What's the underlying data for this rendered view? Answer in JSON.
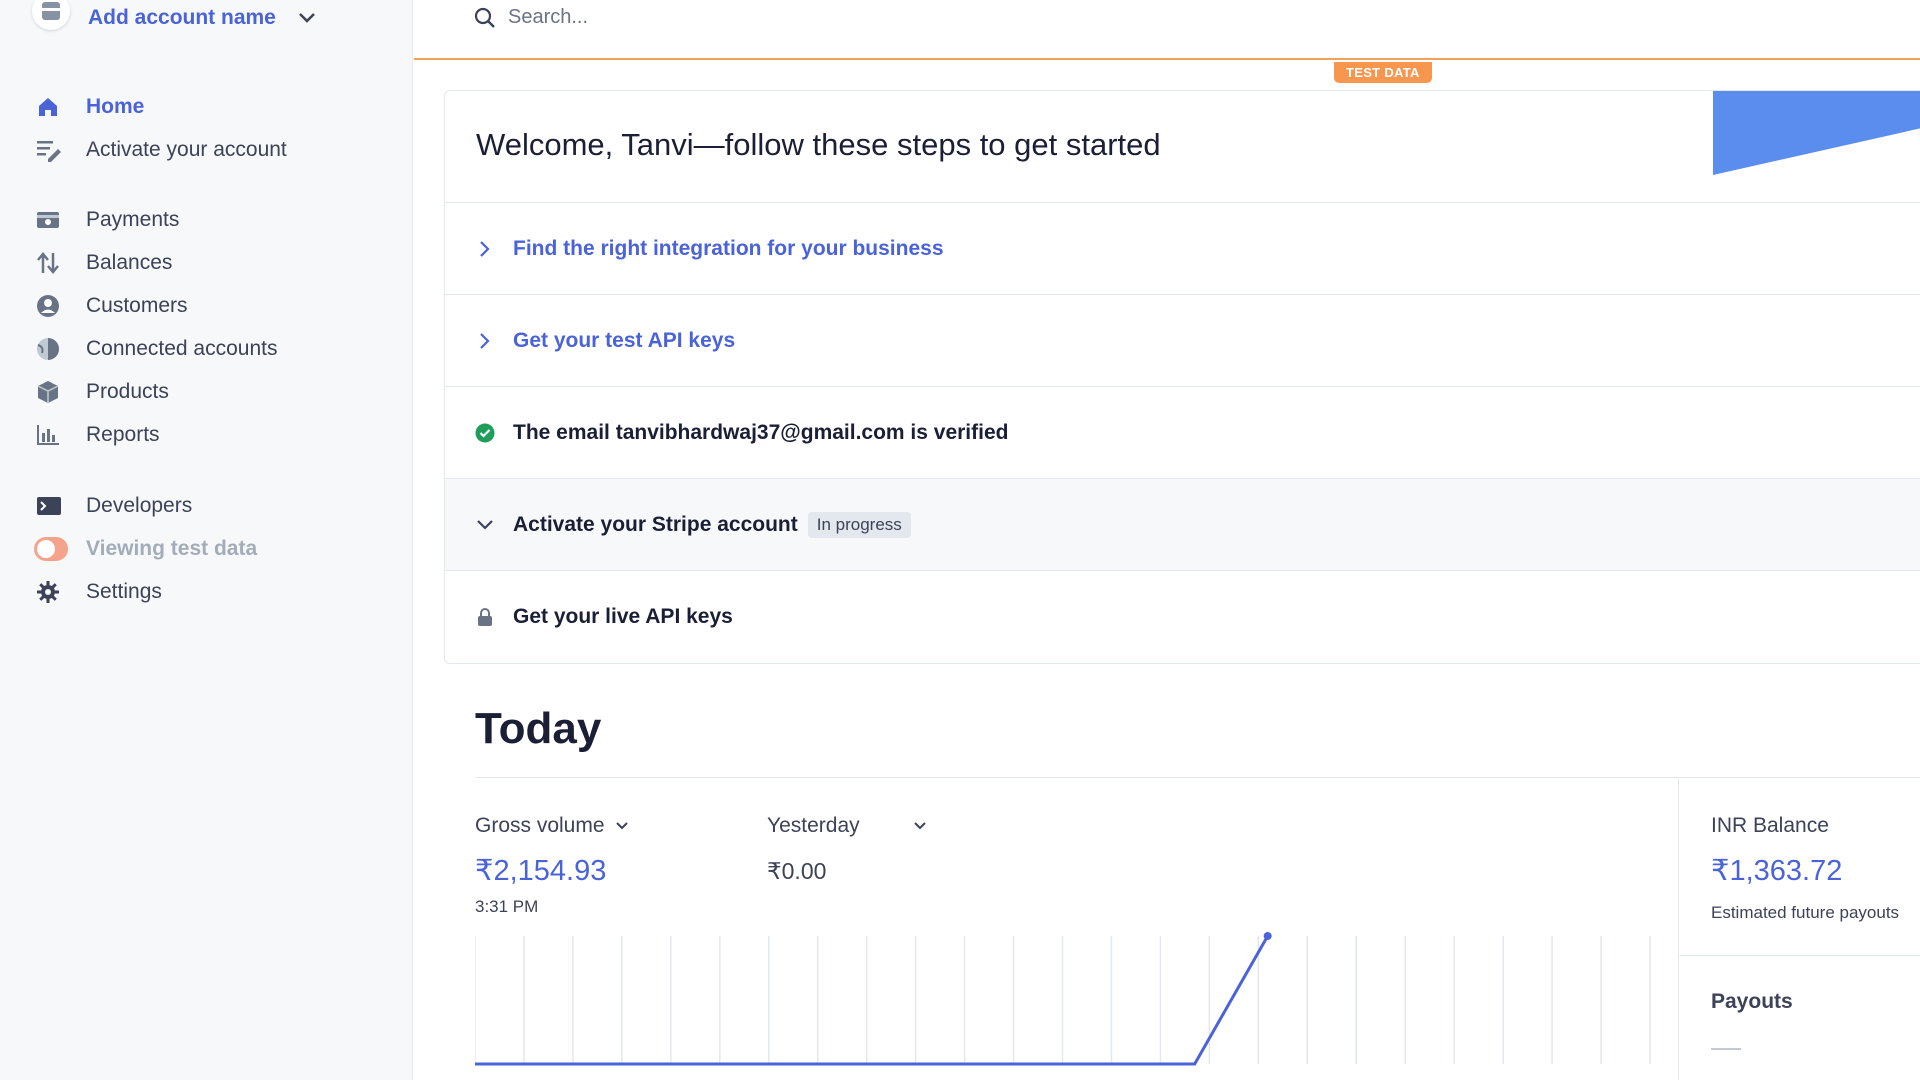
{
  "account": {
    "name": "Add account name",
    "avatar_icon": "store-icon",
    "chevron_icon": "chevron-down-icon"
  },
  "sidebar": {
    "items": [
      {
        "label": "Home",
        "icon": "home-icon"
      },
      {
        "label": "Activate your account",
        "icon": "edit-list-icon"
      },
      {
        "label": "Payments",
        "icon": "wallet-icon"
      },
      {
        "label": "Balances",
        "icon": "arrows-icon"
      },
      {
        "label": "Customers",
        "icon": "user-icon"
      },
      {
        "label": "Connected accounts",
        "icon": "globe-icon"
      },
      {
        "label": "Products",
        "icon": "box-icon"
      },
      {
        "label": "Reports",
        "icon": "bar-chart-icon"
      },
      {
        "label": "Developers",
        "icon": "terminal-icon"
      },
      {
        "label": "Viewing test data",
        "icon": "toggle"
      },
      {
        "label": "Settings",
        "icon": "gear-icon"
      }
    ]
  },
  "search": {
    "placeholder": "Search..."
  },
  "test_badge": "TEST DATA",
  "welcome": {
    "title": "Welcome, Tanvi—follow these steps to get started"
  },
  "steps": [
    {
      "label": "Find the right integration for your business",
      "icon": "chevron-right-icon"
    },
    {
      "label": "Get your test API keys",
      "icon": "chevron-right-icon"
    },
    {
      "label": "The email tanvibhardwaj37@gmail.com is verified",
      "icon": "check-circle-icon"
    },
    {
      "label": "Activate your Stripe account",
      "icon": "chevron-down-icon",
      "badge": "In progress"
    },
    {
      "label": "Get your live API keys",
      "icon": "lock-icon"
    }
  ],
  "today": {
    "title": "Today",
    "gross_volume": {
      "label": "Gross volume",
      "value": "₹2,154.93",
      "time": "3:31 PM"
    },
    "compare": {
      "label": "Yesterday",
      "value": "₹0.00"
    },
    "balance": {
      "label": "INR Balance",
      "value": "₹1,363.72",
      "sub": "Estimated future payouts"
    },
    "payouts": {
      "label": "Payouts"
    }
  },
  "colors": {
    "accent": "#4a63d9",
    "test_orange": "#f7964e",
    "success": "#1e9e5a"
  },
  "chart_data": {
    "type": "line",
    "x": [
      0,
      1,
      2,
      3,
      4,
      5,
      6,
      7,
      8,
      9,
      10,
      11,
      12,
      13,
      14,
      15,
      16,
      17,
      18,
      19,
      20,
      21,
      22,
      23,
      24
    ],
    "values": [
      0,
      0,
      0,
      0,
      0,
      0,
      0,
      0,
      0,
      0,
      0,
      0,
      0,
      0,
      0,
      0,
      2154.93,
      null,
      null,
      null,
      null,
      null,
      null,
      null,
      null
    ],
    "title": "",
    "xlabel": "",
    "ylabel": ""
  }
}
